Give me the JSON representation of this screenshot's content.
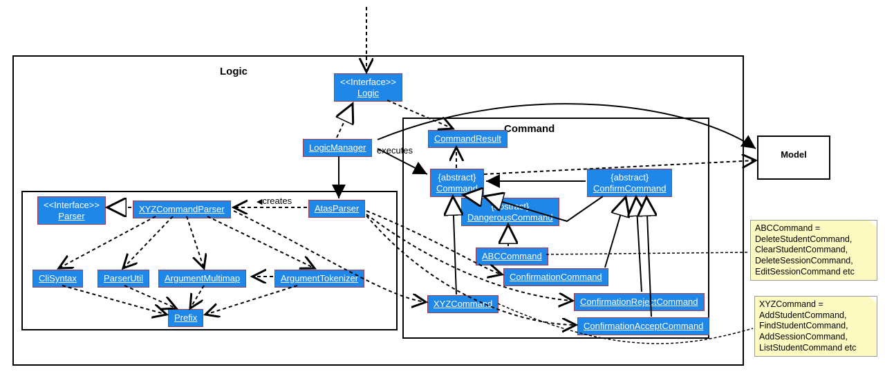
{
  "packages": {
    "logic_label": "Logic",
    "command_label": "Command",
    "model_label": "Model"
  },
  "nodes": {
    "logic_interface": {
      "l1": "<<Interface>>",
      "l2": "Logic"
    },
    "logic_manager": "LogicManager",
    "command_result": "CommandResult",
    "abstract_command": {
      "l1": "{abstract}",
      "l2": "Command"
    },
    "abstract_confirm": {
      "l1": "{abstract}",
      "l2": "ConfirmCommand"
    },
    "abstract_dangerous": {
      "l1": "{abstract}",
      "l2": "DangerousCommand"
    },
    "abc_command": "ABCCommand",
    "confirmation_command": "ConfirmationCommand",
    "xyz_command": "XYZCommand",
    "confirmation_reject": "ConfirmationRejectCommand",
    "confirmation_accept": "ConfirmationAcceptCommand",
    "parser_interface": {
      "l1": "<<Interface>>",
      "l2": "Parser"
    },
    "xyz_parser": "XYZCommandParser",
    "atas_parser": "AtasParser",
    "cli_syntax": "CliSyntax",
    "parser_util": "ParserUtil",
    "argument_multimap": "ArgumentMultimap",
    "argument_tokenizer": "ArgumentTokenizer",
    "prefix": "Prefix"
  },
  "edge_labels": {
    "executes": "executes",
    "creates": "creates"
  },
  "notes": {
    "abc_note": "ABCCommand =\nDeleteStudentCommand,\nClearStudentCommand,\nDeleteSessionCommand,\nEditSessionCommand etc",
    "xyz_note": "XYZCommand =\nAddStudentCommand,\nFindStudentCommand,\nAddSessionCommand,\nListStudentCommand etc"
  }
}
